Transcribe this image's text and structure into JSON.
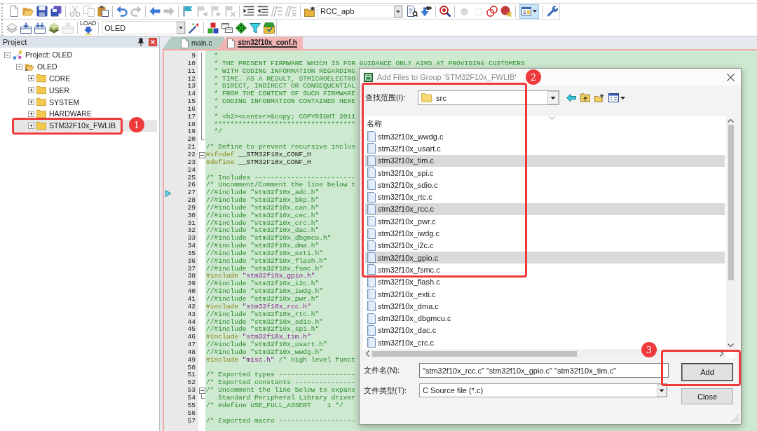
{
  "toolbars": [
    {
      "items": [
        {
          "kind": "button",
          "disabled": false
        },
        {
          "kind": "button",
          "disabled": false
        },
        {
          "kind": "button",
          "disabled": false
        },
        {
          "kind": "button",
          "disabled": false
        },
        {
          "kind": "separator"
        },
        {
          "kind": "button",
          "disabled": true
        },
        {
          "kind": "button",
          "disabled": true
        },
        {
          "kind": "button",
          "disabled": false
        },
        {
          "kind": "separator"
        },
        {
          "kind": "button",
          "disabled": false
        },
        {
          "kind": "button",
          "disabled": true
        },
        {
          "kind": "separator"
        },
        {
          "kind": "button",
          "disabled": false
        },
        {
          "kind": "button",
          "disabled": true
        },
        {
          "kind": "separator"
        },
        {
          "kind": "button",
          "disabled": false
        },
        {
          "kind": "button",
          "disabled": true
        },
        {
          "kind": "button",
          "disabled": true
        },
        {
          "kind": "button",
          "disabled": true
        },
        {
          "kind": "separator"
        },
        {
          "kind": "button",
          "disabled": false
        },
        {
          "kind": "button",
          "disabled": false
        },
        {
          "kind": "button",
          "disabled": true
        },
        {
          "kind": "button",
          "disabled": true
        },
        {
          "kind": "separator"
        },
        {
          "kind": "button",
          "disabled": false
        },
        {
          "kind": "combo",
          "value": "RCC_apb"
        },
        {
          "kind": "button",
          "disabled": false
        },
        {
          "kind": "button",
          "disabled": false
        },
        {
          "kind": "separator"
        },
        {
          "kind": "button",
          "disabled": false
        },
        {
          "kind": "separator"
        },
        {
          "kind": "button",
          "disabled": true
        },
        {
          "kind": "button",
          "disabled": true
        },
        {
          "kind": "button",
          "disabled": false
        },
        {
          "kind": "button",
          "disabled": false
        },
        {
          "kind": "separator"
        },
        {
          "kind": "dropdown",
          "pressed": true
        },
        {
          "kind": "separator"
        },
        {
          "kind": "button",
          "disabled": false
        }
      ]
    },
    {
      "items": [
        {
          "kind": "button",
          "disabled": false
        },
        {
          "kind": "button",
          "disabled": false
        },
        {
          "kind": "button",
          "disabled": false
        },
        {
          "kind": "button",
          "disabled": false
        },
        {
          "kind": "button",
          "disabled": true
        },
        {
          "kind": "separator"
        },
        {
          "kind": "button",
          "label": "LOAD",
          "disabled": false
        },
        {
          "kind": "separator"
        },
        {
          "kind": "combo",
          "value": "OLED"
        },
        {
          "kind": "button",
          "disabled": false
        },
        {
          "kind": "separator"
        },
        {
          "kind": "button",
          "disabled": false
        },
        {
          "kind": "button",
          "disabled": false
        },
        {
          "kind": "button",
          "disabled": false
        },
        {
          "kind": "button",
          "disabled": false
        },
        {
          "kind": "button",
          "disabled": false
        }
      ]
    }
  ],
  "project_panel": {
    "title": "Project",
    "tree": [
      {
        "label": "Project: OLED",
        "kind": "project",
        "expanded": true,
        "selected": false,
        "children": [
          {
            "label": "OLED",
            "kind": "target",
            "expanded": true,
            "selected": false,
            "children": [
              {
                "label": "CORE",
                "kind": "group",
                "expanded": false,
                "selected": false
              },
              {
                "label": "USER",
                "kind": "group",
                "expanded": false,
                "selected": false
              },
              {
                "label": "SYSTEM",
                "kind": "group",
                "expanded": false,
                "selected": false
              },
              {
                "label": "HARDWARE",
                "kind": "group",
                "expanded": false,
                "selected": false
              },
              {
                "label": "STM32F10x_FWLIB",
                "kind": "group",
                "expanded": false,
                "selected": true
              }
            ]
          }
        ]
      }
    ]
  },
  "editor": {
    "tabs": [
      {
        "label": "main.c",
        "selected": false
      },
      {
        "label": "stm32f10x_conf.h",
        "selected": true
      }
    ],
    "lines": [
      {
        "number": "9",
        "kind": "foldbody",
        "marker": false,
        "segments": [
          {
            "kind": "comment",
            "text": "  *"
          }
        ]
      },
      {
        "number": "10",
        "kind": "foldbody",
        "marker": false,
        "segments": [
          {
            "kind": "comment",
            "text": "  * THE PRESENT FIRMWARE WHICH IS FOR GUIDANCE ONLY AIMS AT PROVIDING CUSTOMERS"
          }
        ]
      },
      {
        "number": "11",
        "kind": "foldbody",
        "marker": false,
        "segments": [
          {
            "kind": "comment",
            "text": "  * WITH CODING INFORMATION REGARDING"
          }
        ]
      },
      {
        "number": "12",
        "kind": "foldbody",
        "marker": false,
        "segments": [
          {
            "kind": "comment",
            "text": "  * TIME. AS A RESULT, STMICROELECTRO"
          }
        ]
      },
      {
        "number": "13",
        "kind": "foldbody",
        "marker": false,
        "segments": [
          {
            "kind": "comment",
            "text": "  * DIRECT, INDIRECT OR CONSEQUENTIAL"
          }
        ]
      },
      {
        "number": "14",
        "kind": "foldbody",
        "marker": false,
        "segments": [
          {
            "kind": "comment",
            "text": "  * FROM THE CONTENT OF SUCH FIRMWARE"
          }
        ]
      },
      {
        "number": "15",
        "kind": "foldbody",
        "marker": false,
        "segments": [
          {
            "kind": "comment",
            "text": "  * CODING INFORMATION CONTAINED HERE"
          }
        ]
      },
      {
        "number": "16",
        "kind": "foldbody",
        "marker": false,
        "segments": [
          {
            "kind": "comment",
            "text": "  *"
          }
        ]
      },
      {
        "number": "17",
        "kind": "foldbody",
        "marker": false,
        "segments": [
          {
            "kind": "comment",
            "text": "  * <h2><center>&copy; COPYRIGHT 2011"
          }
        ]
      },
      {
        "number": "18",
        "kind": "foldbody",
        "marker": false,
        "segments": [
          {
            "kind": "comment",
            "text": "  ***********************************"
          }
        ]
      },
      {
        "number": "19",
        "kind": "foldbody",
        "marker": false,
        "segments": [
          {
            "kind": "comment",
            "text": "  */"
          }
        ]
      },
      {
        "number": "20",
        "kind": "foldend",
        "marker": false
      },
      {
        "number": "21",
        "kind": "code",
        "marker": false,
        "segments": [
          {
            "kind": "comment",
            "text": "/* Define to prevent recursive inclus"
          }
        ]
      },
      {
        "number": "22",
        "kind": "foldstart",
        "marker": false,
        "segments": [
          {
            "kind": "directive",
            "text": "#ifndef"
          },
          {
            "kind": "plain",
            "text": " __STM32F10x_CONF_H"
          }
        ]
      },
      {
        "number": "23",
        "kind": "code",
        "marker": false,
        "segments": [
          {
            "kind": "directive",
            "text": "#define"
          },
          {
            "kind": "plain",
            "text": " __STM32F10x_CONF_H"
          }
        ]
      },
      {
        "number": "24",
        "kind": "code",
        "marker": false
      },
      {
        "number": "25",
        "kind": "code",
        "marker": false,
        "segments": [
          {
            "kind": "comment",
            "text": "/* Includes -------------------------"
          }
        ]
      },
      {
        "number": "26",
        "kind": "code",
        "marker": false,
        "segments": [
          {
            "kind": "comment",
            "text": "/* Uncomment/Comment the line below t"
          }
        ]
      },
      {
        "number": "27",
        "kind": "code",
        "marker": true,
        "segments": [
          {
            "kind": "comment",
            "text": "//#include \"stm32f10x_adc.h\""
          }
        ]
      },
      {
        "number": "28",
        "kind": "code",
        "marker": false,
        "segments": [
          {
            "kind": "comment",
            "text": "//#include \"stm32f10x_bkp.h\""
          }
        ]
      },
      {
        "number": "29",
        "kind": "code",
        "marker": false,
        "segments": [
          {
            "kind": "comment",
            "text": "//#include \"stm32f10x_can.h\""
          }
        ]
      },
      {
        "number": "30",
        "kind": "code",
        "marker": false,
        "segments": [
          {
            "kind": "comment",
            "text": "//#include \"stm32f10x_cec.h\""
          }
        ]
      },
      {
        "number": "31",
        "kind": "code",
        "marker": false,
        "segments": [
          {
            "kind": "comment",
            "text": "//#include \"stm32f10x_crc.h\""
          }
        ]
      },
      {
        "number": "32",
        "kind": "code",
        "marker": false,
        "segments": [
          {
            "kind": "comment",
            "text": "//#include \"stm32f10x_dac.h\""
          }
        ]
      },
      {
        "number": "33",
        "kind": "code",
        "marker": false,
        "segments": [
          {
            "kind": "comment",
            "text": "//#include \"stm32f10x_dbgmcu.h\""
          }
        ]
      },
      {
        "number": "34",
        "kind": "code",
        "marker": false,
        "segments": [
          {
            "kind": "comment",
            "text": "//#include \"stm32f10x_dma.h\""
          }
        ]
      },
      {
        "number": "35",
        "kind": "code",
        "marker": false,
        "segments": [
          {
            "kind": "comment",
            "text": "//#include \"stm32f10x_exti.h\""
          }
        ]
      },
      {
        "number": "36",
        "kind": "code",
        "marker": false,
        "segments": [
          {
            "kind": "comment",
            "text": "//#include \"stm32f10x_flash.h\""
          }
        ]
      },
      {
        "number": "37",
        "kind": "code",
        "marker": false,
        "segments": [
          {
            "kind": "comment",
            "text": "//#include \"stm32f10x_fsmc.h\""
          }
        ]
      },
      {
        "number": "38",
        "kind": "code",
        "marker": false,
        "segments": [
          {
            "kind": "directive",
            "text": "#include"
          },
          {
            "kind": "string",
            "text": " \"stm32f10x_gpio.h\""
          }
        ]
      },
      {
        "number": "39",
        "kind": "code",
        "marker": false,
        "segments": [
          {
            "kind": "comment",
            "text": "//#include \"stm32f10x_i2c.h\""
          }
        ]
      },
      {
        "number": "40",
        "kind": "code",
        "marker": false,
        "segments": [
          {
            "kind": "comment",
            "text": "//#include \"stm32f10x_iwdg.h\""
          }
        ]
      },
      {
        "number": "41",
        "kind": "code",
        "marker": false,
        "segments": [
          {
            "kind": "comment",
            "text": "//#include \"stm32f10x_pwr.h\""
          }
        ]
      },
      {
        "number": "42",
        "kind": "code",
        "marker": false,
        "segments": [
          {
            "kind": "directive",
            "text": "#include"
          },
          {
            "kind": "string",
            "text": " \"stm32f10x_rcc.h\""
          }
        ]
      },
      {
        "number": "43",
        "kind": "code",
        "marker": false,
        "segments": [
          {
            "kind": "comment",
            "text": "//#include \"stm32f10x_rtc.h\""
          }
        ]
      },
      {
        "number": "44",
        "kind": "code",
        "marker": false,
        "segments": [
          {
            "kind": "comment",
            "text": "//#include \"stm32f10x_sdio.h\""
          }
        ]
      },
      {
        "number": "45",
        "kind": "code",
        "marker": false,
        "segments": [
          {
            "kind": "comment",
            "text": "//#include \"stm32f10x_spi.h\""
          }
        ]
      },
      {
        "number": "46",
        "kind": "code",
        "marker": false,
        "segments": [
          {
            "kind": "directive",
            "text": "#include"
          },
          {
            "kind": "string",
            "text": " \"stm32f10x_tim.h\""
          }
        ]
      },
      {
        "number": "47",
        "kind": "code",
        "marker": false,
        "segments": [
          {
            "kind": "comment",
            "text": "//#include \"stm32f10x_usart.h\""
          }
        ]
      },
      {
        "number": "48",
        "kind": "code",
        "marker": false,
        "segments": [
          {
            "kind": "comment",
            "text": "//#include \"stm32f10x_wwdg.h\""
          }
        ]
      },
      {
        "number": "49",
        "kind": "code",
        "marker": false,
        "segments": [
          {
            "kind": "directive",
            "text": "#include"
          },
          {
            "kind": "string",
            "text": " \"misc.h\""
          },
          {
            "kind": "comment",
            "text": " /* High level funct"
          }
        ]
      },
      {
        "number": "50",
        "kind": "code",
        "marker": false
      },
      {
        "number": "51",
        "kind": "code",
        "marker": false,
        "segments": [
          {
            "kind": "comment",
            "text": "/* Exported types -------------------"
          }
        ]
      },
      {
        "number": "52",
        "kind": "code",
        "marker": false,
        "segments": [
          {
            "kind": "comment",
            "text": "/* Exported constants ---------------"
          }
        ]
      },
      {
        "number": "53",
        "kind": "foldstart",
        "marker": false,
        "segments": [
          {
            "kind": "comment",
            "text": "/* Uncomment the line below to expans"
          }
        ]
      },
      {
        "number": "54",
        "kind": "foldend",
        "marker": false,
        "segments": [
          {
            "kind": "comment",
            "text": "   Standard Peripheral Library driver"
          }
        ]
      },
      {
        "number": "55",
        "kind": "code",
        "marker": false,
        "segments": [
          {
            "kind": "comment",
            "text": "/* #define USE_FULL_ASSERT    1 */"
          }
        ]
      },
      {
        "number": "56",
        "kind": "code",
        "marker": false
      },
      {
        "number": "57",
        "kind": "code",
        "marker": false,
        "segments": [
          {
            "kind": "comment",
            "text": "/* Exported macro -------------------"
          }
        ]
      }
    ]
  },
  "dialog": {
    "title": "Add Files to Group 'STM32F10x_FWLIB'",
    "look_in": {
      "label": "查找范围(I):",
      "value": "src"
    },
    "files": {
      "header": "名称",
      "items": [
        {
          "name": "stm32f10x_wwdg.c",
          "selected": false
        },
        {
          "name": "stm32f10x_usart.c",
          "selected": false
        },
        {
          "name": "stm32f10x_tim.c",
          "selected": true
        },
        {
          "name": "stm32f10x_spi.c",
          "selected": false
        },
        {
          "name": "stm32f10x_sdio.c",
          "selected": false
        },
        {
          "name": "stm32f10x_rtc.c",
          "selected": false
        },
        {
          "name": "stm32f10x_rcc.c",
          "selected": true
        },
        {
          "name": "stm32f10x_pwr.c",
          "selected": false
        },
        {
          "name": "stm32f10x_iwdg.c",
          "selected": false
        },
        {
          "name": "stm32f10x_i2c.c",
          "selected": false
        },
        {
          "name": "stm32f10x_gpio.c",
          "selected": true
        },
        {
          "name": "stm32f10x_fsmc.c",
          "selected": false
        },
        {
          "name": "stm32f10x_flash.c",
          "selected": false
        },
        {
          "name": "stm32f10x_exti.c",
          "selected": false
        },
        {
          "name": "stm32f10x_dma.c",
          "selected": false
        },
        {
          "name": "stm32f10x_dbgmcu.c",
          "selected": false
        },
        {
          "name": "stm32f10x_dac.c",
          "selected": false
        },
        {
          "name": "stm32f10x_crc.c",
          "selected": false
        }
      ]
    },
    "file_name": {
      "label": "文件名(N):",
      "value": "\"stm32f10x_rcc.c\" \"stm32f10x_gpio.c\" \"stm32f10x_tim.c\""
    },
    "file_type": {
      "label": "文件类型(T):",
      "value": "C Source file (*.c)"
    },
    "buttons": [
      {
        "label": "Add",
        "default": true
      },
      {
        "label": "Close",
        "default": false
      }
    ]
  },
  "annotations": [
    {
      "label": "1"
    },
    {
      "label": "2"
    },
    {
      "label": "3"
    }
  ]
}
